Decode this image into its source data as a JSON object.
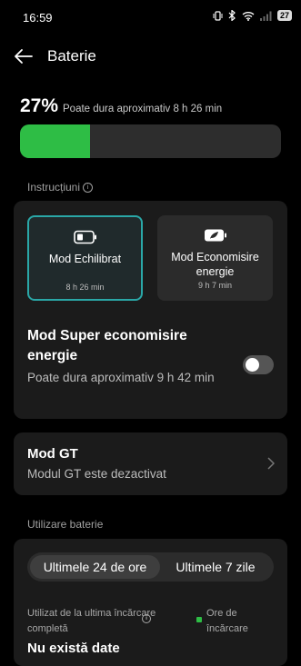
{
  "status_bar": {
    "time": "16:59",
    "battery_badge": "27",
    "icons": [
      "vibrate-icon",
      "bluetooth-icon",
      "wifi-icon",
      "signal-icon",
      "battery-icon"
    ]
  },
  "header": {
    "title": "Baterie",
    "back_icon": "arrow-left-icon"
  },
  "battery": {
    "percent_text": "27%",
    "duration_text": "Poate dura aproximativ 8 h 26 min",
    "level_fraction": 0.27,
    "bar_color": "#2ebd45"
  },
  "instructions": {
    "label": "Instrucțiuni"
  },
  "modes": [
    {
      "name": "Mod Echilibrat",
      "time": "8 h 26 min",
      "icon": "battery-icon",
      "selected": true
    },
    {
      "name": "Mod Economisire energie",
      "time": "9 h 7 min",
      "icon": "leaf-battery-icon",
      "selected": false
    }
  ],
  "super_saver": {
    "title": "Mod Super economisire energie",
    "description": "Poate dura aproximativ 9 h 42 min",
    "enabled": false
  },
  "gt": {
    "title": "Mod GT",
    "description": "Modul GT este dezactivat"
  },
  "usage": {
    "section_label": "Utilizare baterie",
    "tabs": [
      "Ultimele 24 de ore",
      "Ultimele 7 zile"
    ],
    "selected_tab": 0,
    "used_since_label": "Utilizat de la ultima încărcare completă",
    "legend_label": "Ore de încărcare",
    "no_data": "Nu există date"
  },
  "colors": {
    "accent": "#2aa7a7",
    "charge": "#2ebd45"
  }
}
